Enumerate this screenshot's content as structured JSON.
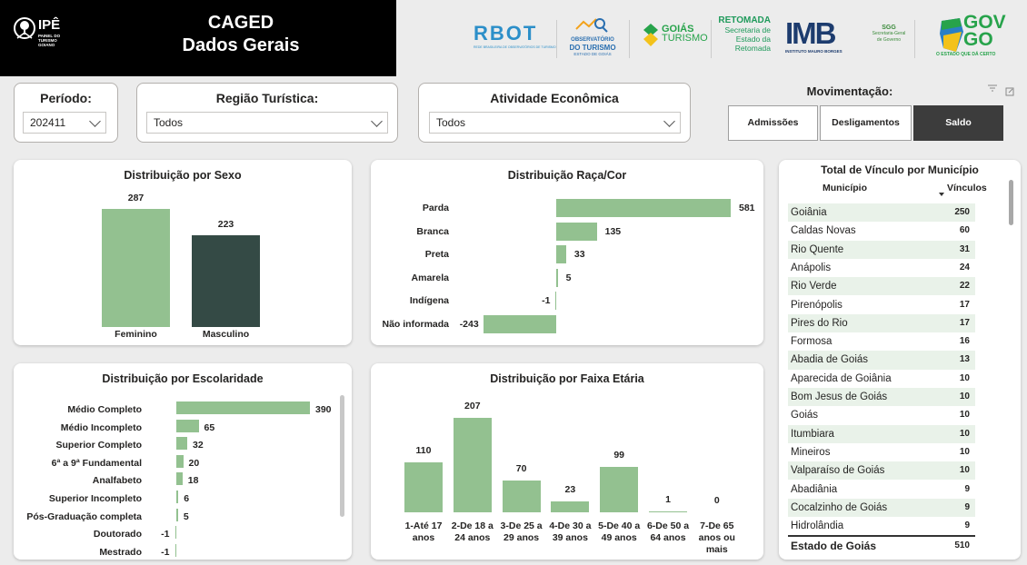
{
  "header": {
    "brand": "IPÊ",
    "brand_sub": "PAINEL DO TURISMO GOIANO",
    "title_line1": "CAGED",
    "title_line2": "Dados Gerais",
    "partners": {
      "rbot": "RBOT",
      "rbot_sub": "REDE BRASILEIRA DE OBSERVATÓRIOS DE TURISMO",
      "obs_line1": "OBSERVATÓRIO",
      "obs_line2": "DO TURISMO",
      "obs_line3": "ESTADO DE GOIÁS",
      "goias_turismo_1": "GOIÁS",
      "goias_turismo_2": "TURISMO",
      "retomada_1": "RETOMADA",
      "retomada_2": "Secretaria de",
      "retomada_3": "Estado da",
      "retomada_4": "Retomada",
      "imb": "IMB",
      "imb_sub": "INSTITUTO MAURO BORGES",
      "sgg_1": "SGG",
      "sgg_2": "Secretaria-Geral",
      "sgg_3": "de Governo",
      "govgo": "GOV GO",
      "govgo_sub": "O ESTADO QUE DÁ CERTO"
    }
  },
  "filters": {
    "periodo": {
      "label": "Período:",
      "value": "202411"
    },
    "regiao": {
      "label": "Região Turística:",
      "value": "Todos"
    },
    "atividade": {
      "label": "Atividade Econômica",
      "value": "Todos"
    }
  },
  "movimentacao": {
    "label": "Movimentação:",
    "options": [
      "Admissões",
      "Desligamentos",
      "Saldo"
    ],
    "selected": "Saldo"
  },
  "colors": {
    "bar": "#93c190",
    "bar_dark": "#344a45",
    "selected": "#3c3c3c",
    "row_alt": "#e9f2e9"
  },
  "sexo": {
    "title": "Distribuição por Sexo",
    "chart_data": {
      "type": "bar",
      "categories": [
        "Feminino",
        "Masculino"
      ],
      "values": [
        287,
        223
      ]
    }
  },
  "raca": {
    "title": "Distribuição Raça/Cor",
    "chart_data": {
      "type": "bar",
      "orientation": "horizontal",
      "categories": [
        "Parda",
        "Branca",
        "Preta",
        "Amarela",
        "Indígena",
        "Não informada"
      ],
      "values": [
        581,
        135,
        33,
        5,
        -1,
        -243
      ]
    }
  },
  "escolaridade": {
    "title": "Distribuição por Escolaridade",
    "chart_data": {
      "type": "bar",
      "orientation": "horizontal",
      "categories": [
        "Médio Completo",
        "Médio Incompleto",
        "Superior Completo",
        "6ª a 9ª Fundamental",
        "Analfabeto",
        "Superior Incompleto",
        "Pós-Graduação completa",
        "Doutorado",
        "Mestrado"
      ],
      "values": [
        390,
        65,
        32,
        20,
        18,
        6,
        5,
        -1,
        -1
      ]
    }
  },
  "faixa": {
    "title": "Distribuição por Faixa Etária",
    "chart_data": {
      "type": "bar",
      "categories": [
        "1-Até 17 anos",
        "2-De 18 a 24 anos",
        "3-De 25 a 29 anos",
        "4-De 30 a 39 anos",
        "5-De 40 a 49 anos",
        "6-De 50 a 64 anos",
        "7-De 65 anos ou mais"
      ],
      "values": [
        110,
        207,
        70,
        23,
        99,
        1,
        0
      ]
    }
  },
  "vinculos": {
    "title": "Total de Vínculo por Município",
    "col_municipio": "Município",
    "col_vinculos": "Vínculos",
    "rows": [
      {
        "municipio": "Goiânia",
        "vinculos": 250
      },
      {
        "municipio": "Caldas Novas",
        "vinculos": 60
      },
      {
        "municipio": "Rio Quente",
        "vinculos": 31
      },
      {
        "municipio": "Anápolis",
        "vinculos": 24
      },
      {
        "municipio": "Rio Verde",
        "vinculos": 22
      },
      {
        "municipio": "Pirenópolis",
        "vinculos": 17
      },
      {
        "municipio": "Pires do Rio",
        "vinculos": 17
      },
      {
        "municipio": "Formosa",
        "vinculos": 16
      },
      {
        "municipio": "Abadia de Goiás",
        "vinculos": 13
      },
      {
        "municipio": "Aparecida de Goiânia",
        "vinculos": 10
      },
      {
        "municipio": "Bom Jesus de Goiás",
        "vinculos": 10
      },
      {
        "municipio": "Goiás",
        "vinculos": 10
      },
      {
        "municipio": "Itumbiara",
        "vinculos": 10
      },
      {
        "municipio": "Mineiros",
        "vinculos": 10
      },
      {
        "municipio": "Valparaíso de Goiás",
        "vinculos": 10
      },
      {
        "municipio": "Abadiânia",
        "vinculos": 9
      },
      {
        "municipio": "Cocalzinho de Goiás",
        "vinculos": 9
      },
      {
        "municipio": "Hidrolândia",
        "vinculos": 9
      }
    ],
    "total_label": "Estado de Goiás",
    "total_value": 510
  }
}
